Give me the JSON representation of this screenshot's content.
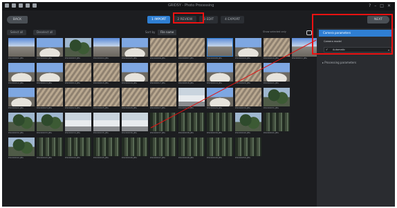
{
  "window": {
    "title": "GRIDSY - Photo Processing",
    "icons": [
      "app-icon",
      "new-icon",
      "open-icon",
      "save-icon",
      "settings-icon"
    ],
    "controls": [
      "help-icon",
      "minimize-icon",
      "maximize-icon",
      "close-icon"
    ]
  },
  "nav": {
    "back_label": "BACK",
    "next_label": "NEXT",
    "steps": [
      {
        "label": "1 IMPORT",
        "active": true
      },
      {
        "label": "2 REVIEW",
        "active": false
      },
      {
        "label": "3 EDIT",
        "active": false
      },
      {
        "label": "4 EXPORT",
        "active": false
      }
    ]
  },
  "filterbar": {
    "chips": [
      "Select all",
      "Deselect all"
    ],
    "sort_label": "Sort by",
    "sort_value": "File name",
    "hint": "Show selected only"
  },
  "photos": {
    "rows": [
      [
        {
          "name": "DSC00001.JPG",
          "kind": "sky"
        },
        {
          "name": "DSC00002.JPG",
          "kind": "dome"
        },
        {
          "name": "DSC00003.JPG",
          "kind": "tree"
        },
        {
          "name": "DSC00004.JPG",
          "kind": "sky"
        },
        {
          "name": "DSC00005.JPG",
          "kind": "dome"
        },
        {
          "name": "DSC00006.JPG",
          "kind": "deck"
        },
        {
          "name": "DSC00007.JPG",
          "kind": "deck"
        },
        {
          "name": "DSC00008.JPG",
          "kind": "sky",
          "selected": true
        },
        {
          "name": "DSC00009.JPG",
          "kind": "dome"
        },
        {
          "name": "DSC00010.JPG",
          "kind": "deck"
        },
        {
          "name": "DSC00011.JPG",
          "kind": "sky"
        }
      ],
      [
        {
          "name": "DSC00012.JPG",
          "kind": "dome"
        },
        {
          "name": "DSC00013.JPG",
          "kind": "dome"
        },
        {
          "name": "DSC00014.JPG",
          "kind": "deck"
        },
        {
          "name": "DSC00015.JPG",
          "kind": "deck"
        },
        {
          "name": "DSC00016.JPG",
          "kind": "dome"
        },
        {
          "name": "DSC00017.JPG",
          "kind": "deck"
        },
        {
          "name": "DSC00018.JPG",
          "kind": "deck"
        },
        {
          "name": "DSC00019.JPG",
          "kind": "dome"
        },
        {
          "name": "DSC00020.JPG",
          "kind": "deck"
        },
        {
          "name": "DSC00021.JPG",
          "kind": "dome"
        }
      ],
      [
        {
          "name": "DSC00022.JPG",
          "kind": "dome"
        },
        {
          "name": "DSC00023.JPG",
          "kind": "deck"
        },
        {
          "name": "DSC00024.JPG",
          "kind": "deck"
        },
        {
          "name": "DSC00025.JPG",
          "kind": "deck"
        },
        {
          "name": "DSC00026.JPG",
          "kind": "deck"
        },
        {
          "name": "DSC00027.JPG",
          "kind": "deck"
        },
        {
          "name": "DSC00028.JPG",
          "kind": "snow"
        },
        {
          "name": "DSC00029.JPG",
          "kind": "dome"
        },
        {
          "name": "DSC00030.JPG",
          "kind": "deck"
        },
        {
          "name": "DSC00031.JPG",
          "kind": "tree"
        }
      ],
      [
        {
          "name": "DSC00032.JPG",
          "kind": "tree"
        },
        {
          "name": "DSC00033.JPG",
          "kind": "tree"
        },
        {
          "name": "DSC00034.JPG",
          "kind": "snow"
        },
        {
          "name": "DSC00035.JPG",
          "kind": "snow"
        },
        {
          "name": "DSC00036.JPG",
          "kind": "snow"
        },
        {
          "name": "DSC00037.JPG",
          "kind": "forest"
        },
        {
          "name": "DSC00038.JPG",
          "kind": "forest"
        },
        {
          "name": "DSC00039.JPG",
          "kind": "forest"
        },
        {
          "name": "DSC00040.JPG",
          "kind": "tree"
        },
        {
          "name": "DSC00041.JPG",
          "kind": "forest"
        }
      ],
      [
        {
          "name": "DSC00042.JPG",
          "kind": "tree"
        },
        {
          "name": "DSC00043.JPG",
          "kind": "forest"
        },
        {
          "name": "DSC00044.JPG",
          "kind": "forest"
        },
        {
          "name": "DSC00045.JPG",
          "kind": "forest"
        },
        {
          "name": "DSC00046.JPG",
          "kind": "forest"
        },
        {
          "name": "DSC00047.JPG",
          "kind": "forest"
        },
        {
          "name": "DSC00048.JPG",
          "kind": "forest"
        },
        {
          "name": "DSC00049.JPG",
          "kind": "forest"
        },
        {
          "name": "DSC00050.JPG",
          "kind": "forest"
        }
      ]
    ]
  },
  "panel": {
    "section1_title": "Camera parameters",
    "sub_label": "Camera model",
    "dropdown_value": "Automatic",
    "section2_title": "Processing parameters"
  },
  "colors": {
    "accent": "#2f7fd3",
    "annotation": "#e11111",
    "background": "#1c1d20"
  }
}
